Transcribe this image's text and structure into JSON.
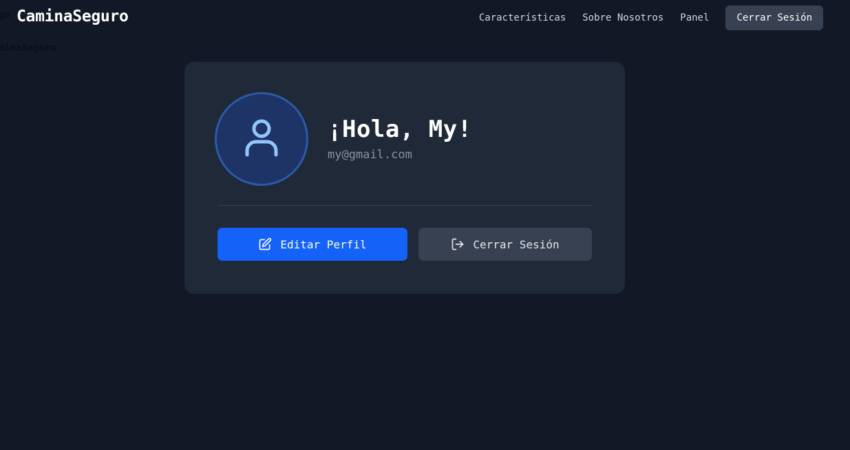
{
  "stray_text": {
    "line1": "go",
    "line2": "minaSeguro"
  },
  "navbar": {
    "brand": "CaminaSeguro",
    "links": [
      "Características",
      "Sobre Nosotros",
      "Panel"
    ],
    "logout_label": "Cerrar Sesión"
  },
  "profile": {
    "greeting": "¡Hola, My!",
    "email": "my@gmail.com",
    "edit_label": "Editar Perfil",
    "logout_label": "Cerrar Sesión"
  },
  "colors": {
    "background": "#121826",
    "card": "#1f2937",
    "primary": "#1562f9",
    "secondary": "#374151",
    "avatar_bg": "#1e3366",
    "avatar_icon": "#93c5fd"
  },
  "icons": {
    "avatar": "user-icon",
    "edit": "edit-icon",
    "logout": "logout-icon"
  }
}
